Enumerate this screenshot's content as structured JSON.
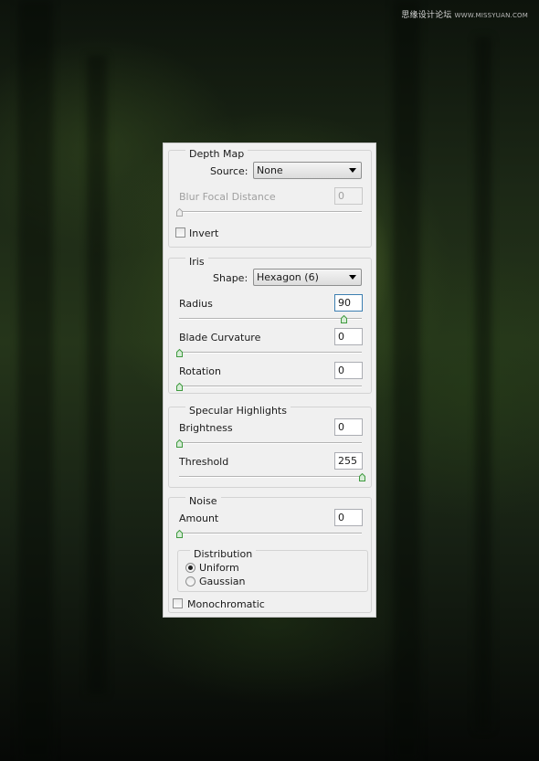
{
  "watermark": {
    "text": "思缘设计论坛",
    "url_text": "WWW.MISSYUAN.COM"
  },
  "depth_map": {
    "legend": "Depth Map",
    "source_label": "Source:",
    "source_value": "None",
    "blur_focal_label": "Blur Focal Distance",
    "blur_focal_value": "0",
    "blur_focal_level": 0,
    "invert_label": "Invert",
    "invert_checked": false
  },
  "iris": {
    "legend": "Iris",
    "shape_label": "Shape:",
    "shape_value": "Hexagon (6)",
    "radius_label": "Radius",
    "radius_value": "90",
    "radius_level": 0.9,
    "blade_label": "Blade Curvature",
    "blade_value": "0",
    "blade_level": 0,
    "rotation_label": "Rotation",
    "rotation_value": "0",
    "rotation_level": 0
  },
  "specular": {
    "legend": "Specular Highlights",
    "brightness_label": "Brightness",
    "brightness_value": "0",
    "brightness_level": 0,
    "threshold_label": "Threshold",
    "threshold_value": "255",
    "threshold_level": 1
  },
  "noise": {
    "legend": "Noise",
    "amount_label": "Amount",
    "amount_value": "0",
    "amount_level": 0,
    "distribution_legend": "Distribution",
    "uniform_label": "Uniform",
    "gaussian_label": "Gaussian",
    "selected": "Uniform",
    "mono_label": "Monochromatic",
    "mono_checked": false
  },
  "colors": {
    "thumb_fill": "#d6ecd6",
    "thumb_accent": "#3f9a3f",
    "focus_border": "#3c7fb1"
  }
}
